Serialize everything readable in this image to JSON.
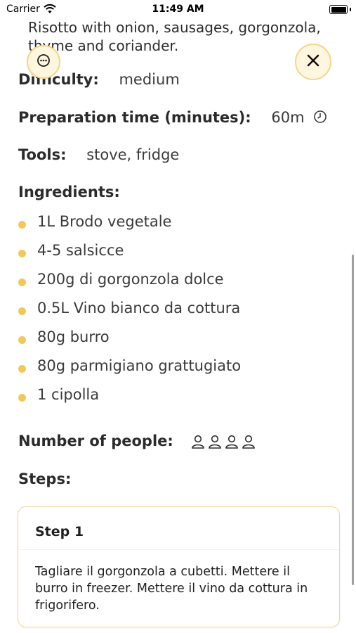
{
  "status_bar": {
    "carrier": "Carrier",
    "time": "11:49 AM"
  },
  "recipe": {
    "description": "Risotto with onion, sausages, gorgonzola, thyme and coriander.",
    "difficulty_label": "Difficulty:",
    "difficulty_value": "medium",
    "prep_label": "Preparation time (minutes):",
    "prep_value": "60m",
    "tools_label": "Tools:",
    "tools_value": "stove, fridge",
    "ingredients_label": "Ingredients:",
    "ingredients": [
      "1L Brodo vegetale",
      "4-5 salsicce",
      "200g di gorgonzola dolce",
      "0.5L Vino bianco da cottura",
      "80g burro",
      "80g parmigiano grattugiato",
      "1 cipolla"
    ],
    "people_label": "Number of people:",
    "people_count": 4,
    "steps_label": "Steps:",
    "steps": [
      {
        "title": "Step 1",
        "text": "Tagliare il gorgonzola a cubetti. Mettere il burro in freezer. Mettere il vino da cottura in frigorifero."
      }
    ]
  },
  "icons": {
    "more": "more-options-icon",
    "close": "close-icon",
    "clock": "clock-icon",
    "person": "person-icon"
  },
  "colors": {
    "accent": "#f0c95a",
    "accent_bg": "#fff6df",
    "card_border": "#f0d79a"
  }
}
